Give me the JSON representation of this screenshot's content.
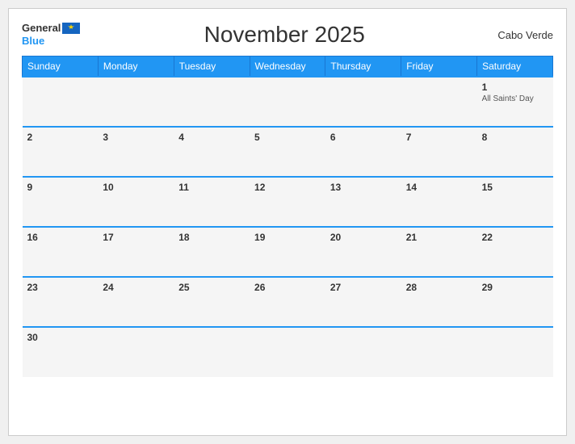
{
  "header": {
    "logo_general": "General",
    "logo_blue": "Blue",
    "title": "November 2025",
    "country": "Cabo Verde"
  },
  "weekdays": [
    "Sunday",
    "Monday",
    "Tuesday",
    "Wednesday",
    "Thursday",
    "Friday",
    "Saturday"
  ],
  "weeks": [
    [
      {
        "num": "",
        "holiday": ""
      },
      {
        "num": "",
        "holiday": ""
      },
      {
        "num": "",
        "holiday": ""
      },
      {
        "num": "",
        "holiday": ""
      },
      {
        "num": "",
        "holiday": ""
      },
      {
        "num": "",
        "holiday": ""
      },
      {
        "num": "1",
        "holiday": "All Saints' Day"
      }
    ],
    [
      {
        "num": "2",
        "holiday": ""
      },
      {
        "num": "3",
        "holiday": ""
      },
      {
        "num": "4",
        "holiday": ""
      },
      {
        "num": "5",
        "holiday": ""
      },
      {
        "num": "6",
        "holiday": ""
      },
      {
        "num": "7",
        "holiday": ""
      },
      {
        "num": "8",
        "holiday": ""
      }
    ],
    [
      {
        "num": "9",
        "holiday": ""
      },
      {
        "num": "10",
        "holiday": ""
      },
      {
        "num": "11",
        "holiday": ""
      },
      {
        "num": "12",
        "holiday": ""
      },
      {
        "num": "13",
        "holiday": ""
      },
      {
        "num": "14",
        "holiday": ""
      },
      {
        "num": "15",
        "holiday": ""
      }
    ],
    [
      {
        "num": "16",
        "holiday": ""
      },
      {
        "num": "17",
        "holiday": ""
      },
      {
        "num": "18",
        "holiday": ""
      },
      {
        "num": "19",
        "holiday": ""
      },
      {
        "num": "20",
        "holiday": ""
      },
      {
        "num": "21",
        "holiday": ""
      },
      {
        "num": "22",
        "holiday": ""
      }
    ],
    [
      {
        "num": "23",
        "holiday": ""
      },
      {
        "num": "24",
        "holiday": ""
      },
      {
        "num": "25",
        "holiday": ""
      },
      {
        "num": "26",
        "holiday": ""
      },
      {
        "num": "27",
        "holiday": ""
      },
      {
        "num": "28",
        "holiday": ""
      },
      {
        "num": "29",
        "holiday": ""
      }
    ],
    [
      {
        "num": "30",
        "holiday": ""
      },
      {
        "num": "",
        "holiday": ""
      },
      {
        "num": "",
        "holiday": ""
      },
      {
        "num": "",
        "holiday": ""
      },
      {
        "num": "",
        "holiday": ""
      },
      {
        "num": "",
        "holiday": ""
      },
      {
        "num": "",
        "holiday": ""
      }
    ]
  ]
}
